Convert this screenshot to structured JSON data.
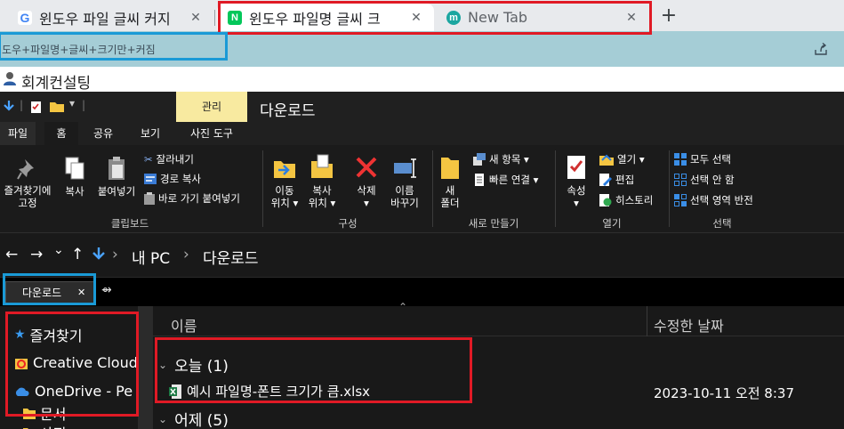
{
  "browser": {
    "tabs": [
      {
        "title": "윈도우 파일 글씨 커지",
        "favicon": "google-icon",
        "active": false
      },
      {
        "title": "윈도우 파일명 글씨 크",
        "favicon": "naver-cafe-icon",
        "active": true
      },
      {
        "title": "New Tab",
        "favicon": "new-tab-icon",
        "active": false
      }
    ],
    "close_glyph": "✕",
    "new_tab_glyph": "+"
  },
  "url_strip": {
    "text": "도우+파일명+글씨+크기만+커짐"
  },
  "cafe": {
    "name": "회계컨설팅"
  },
  "explorer": {
    "contextual_tab": "관리",
    "window_title": "다운로드",
    "ribbon_tabs": [
      "파일",
      "홈",
      "공유",
      "보기",
      "사진 도구"
    ],
    "clipboard": {
      "pin": [
        "즐겨찾기에",
        "고정"
      ],
      "copy": "복사",
      "paste": "붙여넣기",
      "cut": "잘라내기",
      "copy_path": "경로 복사",
      "paste_shortcut": "바로 가기 붙여넣기",
      "label": "클립보드"
    },
    "organize": {
      "move": [
        "이동",
        "위치 ▾"
      ],
      "copy_to": [
        "복사",
        "위치 ▾"
      ],
      "delete": [
        "삭제",
        "▾"
      ],
      "rename": [
        "이름",
        "바꾸기"
      ],
      "label": "구성"
    },
    "new": {
      "folder": [
        "새",
        "폴더"
      ],
      "new_item": "새 항목 ▾",
      "easy_access": "빠른 연결 ▾",
      "label": "새로 만들기"
    },
    "open": {
      "properties": [
        "속성",
        "▾"
      ],
      "open": "열기 ▾",
      "edit": "편집",
      "history": "히스토리",
      "label": "열기"
    },
    "select": {
      "all": "모두 선택",
      "none": "선택 안 함",
      "invert": "선택 영역 반전",
      "label": "선택"
    },
    "nav": {
      "back": "←",
      "forward": "→",
      "recent": "⌄",
      "up": "↑",
      "crumbs": [
        "내 PC",
        "다운로드"
      ],
      "crumb_sep": "›"
    },
    "path_tab": {
      "label": "다운로드",
      "close": "✕"
    },
    "sidebar": [
      {
        "label": "즐겨찾기",
        "icon": "star-icon"
      },
      {
        "label": "Creative Cloud",
        "icon": "creative-cloud-icon"
      },
      {
        "label": "OneDrive - Pe",
        "icon": "onedrive-icon"
      },
      {
        "label": "문서",
        "icon": "folder-icon"
      },
      {
        "label": "사진",
        "icon": "folder-icon"
      }
    ],
    "columns": {
      "name": "이름",
      "modified": "수정한 날짜"
    },
    "groups": [
      {
        "label": "오늘 (1)",
        "expanded": true
      },
      {
        "label": "어제 (5)",
        "expanded": false
      }
    ],
    "file": {
      "name": "예시 파일명-폰트 크기가 큼.xlsx",
      "date": "2023-10-11 오전 8:37"
    }
  },
  "colors": {
    "annotation_red": "#e01a25",
    "annotation_blue": "#1a9ad6",
    "ribbon_bg": "#1b1b1b",
    "contextual_tab": "#f8eaa0"
  }
}
